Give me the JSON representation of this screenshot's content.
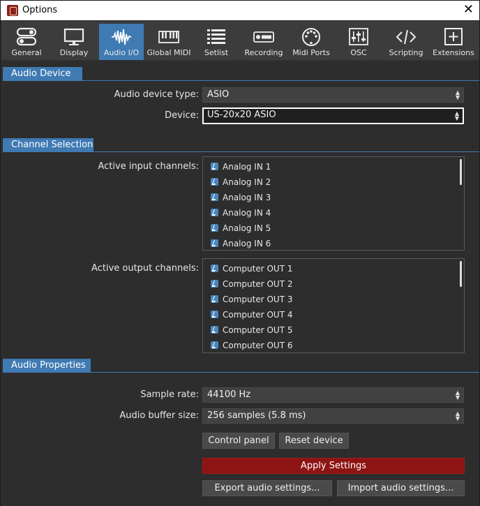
{
  "window": {
    "title": "Options"
  },
  "toolbar": {
    "tabs": [
      {
        "label": "General",
        "icon": "toggles-icon"
      },
      {
        "label": "Display",
        "icon": "monitor-icon"
      },
      {
        "label": "Audio I/O",
        "icon": "waveform-icon"
      },
      {
        "label": "Global MIDI",
        "icon": "piano-keys-icon"
      },
      {
        "label": "Setlist",
        "icon": "list-icon"
      },
      {
        "label": "Recording",
        "icon": "rec-icon"
      },
      {
        "label": "Midi Ports",
        "icon": "midi-port-icon"
      },
      {
        "label": "OSC",
        "icon": "mixer-icon"
      },
      {
        "label": "Scripting",
        "icon": "code-icon"
      },
      {
        "label": "Extensions",
        "icon": "plus-box-icon"
      }
    ],
    "active_tab": "Audio I/O",
    "accent_color": "#3f7ab3"
  },
  "audio_device": {
    "header": "Audio Device",
    "type_label": "Audio device type:",
    "type_value": "ASIO",
    "device_label": "Device:",
    "device_value": "US-20x20 ASIO"
  },
  "channels": {
    "header": "Channel Selection",
    "input_label": "Active input channels:",
    "inputs": [
      "Analog IN 1",
      "Analog IN 2",
      "Analog IN 3",
      "Analog IN 4",
      "Analog IN 5",
      "Analog IN 6"
    ],
    "output_label": "Active output channels:",
    "outputs": [
      "Computer OUT 1",
      "Computer OUT 2",
      "Computer OUT 3",
      "Computer OUT 4",
      "Computer OUT 5",
      "Computer OUT 6"
    ]
  },
  "audio_properties": {
    "header": "Audio Properties",
    "sample_rate_label": "Sample rate:",
    "sample_rate_value": "44100 Hz",
    "buffer_label": "Audio buffer size:",
    "buffer_value": "256 samples (5.8 ms)"
  },
  "buttons": {
    "control_panel": "Control panel",
    "reset_device": "Reset device",
    "apply": "Apply Settings",
    "export": "Export audio settings...",
    "import": "Import audio settings..."
  }
}
